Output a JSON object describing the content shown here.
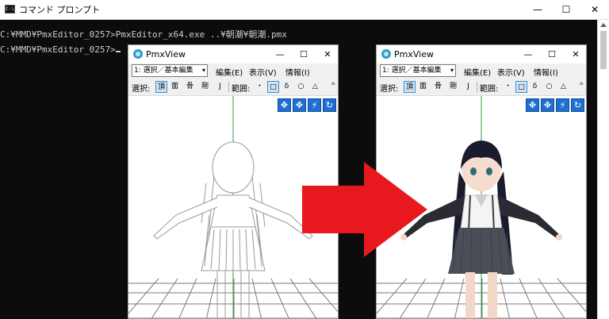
{
  "cmd_window": {
    "title": "コマンド プロンプト",
    "icon": "console-icon",
    "controls": {
      "minimize": "—",
      "maximize": "☐",
      "close": "✕"
    },
    "lines": [
      "C:¥MMD¥PmxEditor_0257>PmxEditor_x64.exe ..¥朝潮¥朝潮.pmx",
      "C:¥MMD¥PmxEditor_0257>"
    ]
  },
  "pmx_views": [
    {
      "title": "PmxView",
      "mode": "1: 選択／基本編集",
      "menu": [
        "編集(E)",
        "表示(V)",
        "情報(I)"
      ],
      "toolbar": {
        "select_label": "選択:",
        "btn_vertex": "頂",
        "btn_face": "面",
        "btn_bone": "骨",
        "btn_rigid": "剛",
        "btn_joint": "J",
        "range_label": "範囲:",
        "range_dot": "・",
        "range_square": "□",
        "range_lasso": "δ",
        "range_circle": "○",
        "range_triangle": "△",
        "more": "»"
      },
      "render_state": "wireframe"
    },
    {
      "title": "PmxView",
      "mode": "1: 選択／基本編集",
      "menu": [
        "編集(E)",
        "表示(V)",
        "情報(I)"
      ],
      "toolbar": {
        "select_label": "選択:",
        "btn_vertex": "頂",
        "btn_face": "面",
        "btn_bone": "骨",
        "btn_rigid": "剛",
        "btn_joint": "J",
        "range_label": "範囲:",
        "range_dot": "・",
        "range_square": "□",
        "range_lasso": "δ",
        "range_circle": "○",
        "range_triangle": "△",
        "more": "»"
      },
      "render_state": "textured"
    }
  ],
  "colors": {
    "arrow": "#e8191e",
    "console_bg": "#0c0c0c",
    "nav_button": "#1f6fd0",
    "grid": "#7a7a7a",
    "axis": "#2ea043"
  }
}
